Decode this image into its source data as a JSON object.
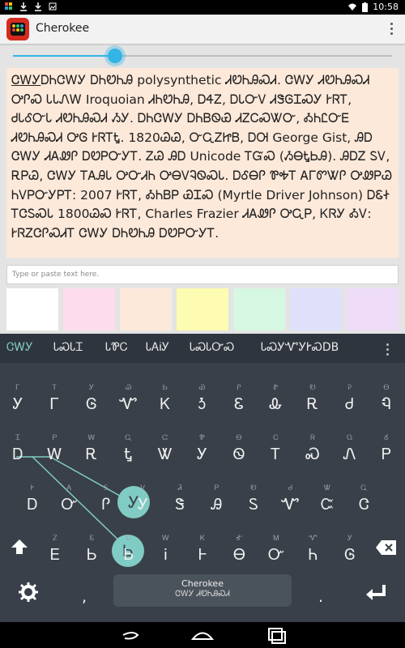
{
  "status_bar": {
    "time": "10:58"
  },
  "app": {
    "title": "Cherokee"
  },
  "slider": {
    "value_fraction": 0.27
  },
  "text_content": {
    "underlined_word": "ᏣᎳᎩ",
    "rest": "ᎠᏂᏣᎳᎩ ᎠᏂᏬᏂᎯ polysynthetic ᏗᏬᏂᎯᏍᏗ. ᏣᎳᎩ ᏗᏬᏂᎯᏍᏗ ᎤᎵᏍ ᏓᏓᏁᎳ Iroquoian ᏗᏂᏬᏂᎯ, ᎠᏎᏃ, ᎠᏓᏅᏙ ᏗᏕᎶᏆᏍᎩ ᎨᏒᎢ, ᏧᏓᎴᏅᏓ ᏗᏬᏂᎯᏍᏗ ᏱᎩ. ᎠᏂᏣᎳᎩ ᎠᏂᏴᏫᏯ ᏗᏃᏟᏍᏔᏅ, ᎣᏂᏝᏅᎬ ᏗᏬᏂᎯᏍᏗ ᎤᎶ ᎨᏒᎢᎿ. 1820ᏊᏊ, ᏅᏩᏃᏥᏴ, ᎠᎺ George Gist, ᎯᎠ ᏣᎳᎩ ᏗᎪᏪᎵ ᎠᏬᏢᏅᎩᎢ. ᏃᏊ ᎯᎠ Unicode ᎢᏳᏍ (ᏱᎾᎿᏏᎯ). ᎯᎠᏃ ᏚᏙ, ᎡᏢᏊ, ᏣᎳᎩ ᎢᎪᎯᏓ ᎤᏅᏗᏂ ᎤᎾᏙᎸᏫᏍᏓ. ᎠᎴᎾᎵ ᏈᎭᎢ ᎪᎱᏛᏔᎵ ᎤᏪᏢᏊ ᏂᏙᏢᏅᎩᏢᎢ: 2007 ᎨᏒᎢ, ᎣᏂᏴᏢ ᏯᏆᏍ (Myrtle Driver Johnson) ᎠᏋᏐ ᎢᏣᏚᏍᏓ 1800ᏊᏍ ᎨᏒᎢ, Charles Frazier ᏗᎪᏪᎵ ᎤᏩᏢ, ᏦᏒᎩ ᎣᏙ: ᎨᏒᏃᏣᎵᏍᏗᎢ ᏣᎳᎩ ᎠᏂᏬᏂᎯ ᎠᏬᏢᏅᎩᎢ."
  },
  "input": {
    "placeholder": "Type or paste text here."
  },
  "swatches": [
    "#ffffff",
    "#fddcec",
    "#fde9da",
    "#fdfcb0",
    "#d6f7e2",
    "#dfe1fb",
    "#efdcf9"
  ],
  "suggestions": [
    "ᏣᎳᎩ",
    "ᏓᏍᏓᏆ",
    "ᏓᏈᏟ",
    "ᏓᎪᎥᎩ",
    "ᏓᏍᏓᏅᏍ",
    "ᏓᏍᎩᏉᎩᎨᏍDB"
  ],
  "keys": {
    "row1": [
      [
        "Ꭹ",
        "Ꮁ"
      ],
      [
        "Ꮁ",
        "Ꭲ"
      ],
      [
        "Ꮆ",
        "Ꭹ"
      ],
      [
        "Ꮙ",
        "Ꮚ"
      ],
      [
        "Ꮶ",
        "Ꮟ"
      ],
      [
        "Ꮌ",
        "Ꮿ"
      ],
      [
        "Ꮛ",
        "Ꮅ"
      ],
      [
        "Ꮂ",
        "Ꮡ"
      ],
      [
        "Ꭱ",
        "Ꭷ"
      ],
      [
        "Ꮷ",
        "Ꭾ"
      ],
      [
        "Ꮔ",
        "Ꮎ"
      ]
    ],
    "row2": [
      [
        "Ꭰ",
        "Ꮖ"
      ],
      [
        "Ꮃ",
        "Ꮲ"
      ],
      [
        "Ꭱ",
        "Ꮃ"
      ],
      [
        "Ꮏ",
        "Ꮹ"
      ],
      [
        "Ꮤ",
        "Ꮸ"
      ],
      [
        "Ꭹ",
        "Ꮘ"
      ],
      [
        "Ꮻ",
        "Ꮎ"
      ],
      [
        "Ꭲ",
        "Ꮯ"
      ],
      [
        "Ꮝ",
        "Ꮢ"
      ],
      [
        "Ꮑ",
        "Ꮐ"
      ],
      [
        "Ꮲ",
        "Ꮄ"
      ]
    ],
    "row3": [
      [
        "Ꭰ",
        "Ꭸ"
      ],
      [
        "Ꮕ",
        "Ꭺ"
      ],
      [
        "Ꮅ",
        "Ꮪ"
      ],
      [
        "Ꭹ",
        "Ꮩ"
      ],
      [
        "Ꮥ",
        "Ꮨ"
      ],
      [
        "Ꭿ",
        "Ꮲ"
      ],
      [
        "Ꮪ",
        "Ꭷ"
      ],
      [
        "Ꮙ",
        "Ꮷ"
      ],
      [
        "Ꮸ",
        "Ꮤ"
      ],
      [
        "Ꮳ",
        "Ꮹ"
      ]
    ],
    "row4": [
      [
        "Ꭼ",
        "Ꮓ"
      ],
      [
        "Ꮟ",
        "Ꮛ"
      ],
      [
        "Ꮟ",
        "Ꮳ"
      ],
      [
        "Ꭵ",
        "Ꮃ"
      ],
      [
        "Ꮀ",
        "Ꮶ"
      ],
      [
        "Ꮎ",
        "Ꮉ"
      ],
      [
        "Ꮕ",
        "Ꮇ"
      ],
      [
        "Ꮒ",
        "Ꮙ"
      ],
      [
        "Ꮆ",
        "Ꭹ"
      ]
    ]
  },
  "gesture_bubbles": [
    "Ꭹ",
    "Ꮟ"
  ],
  "spacebar": {
    "label": "Cherokee",
    "sublabel": "ᏣᎳᎩ ᏗᏬᏂᎯᏍᏗ"
  },
  "keys_misc": {
    "comma": ",",
    "period": "."
  },
  "colors": {
    "accent": "#33b5e5",
    "keyboard_bg": "#394049",
    "gesture": "#80cbc4"
  }
}
